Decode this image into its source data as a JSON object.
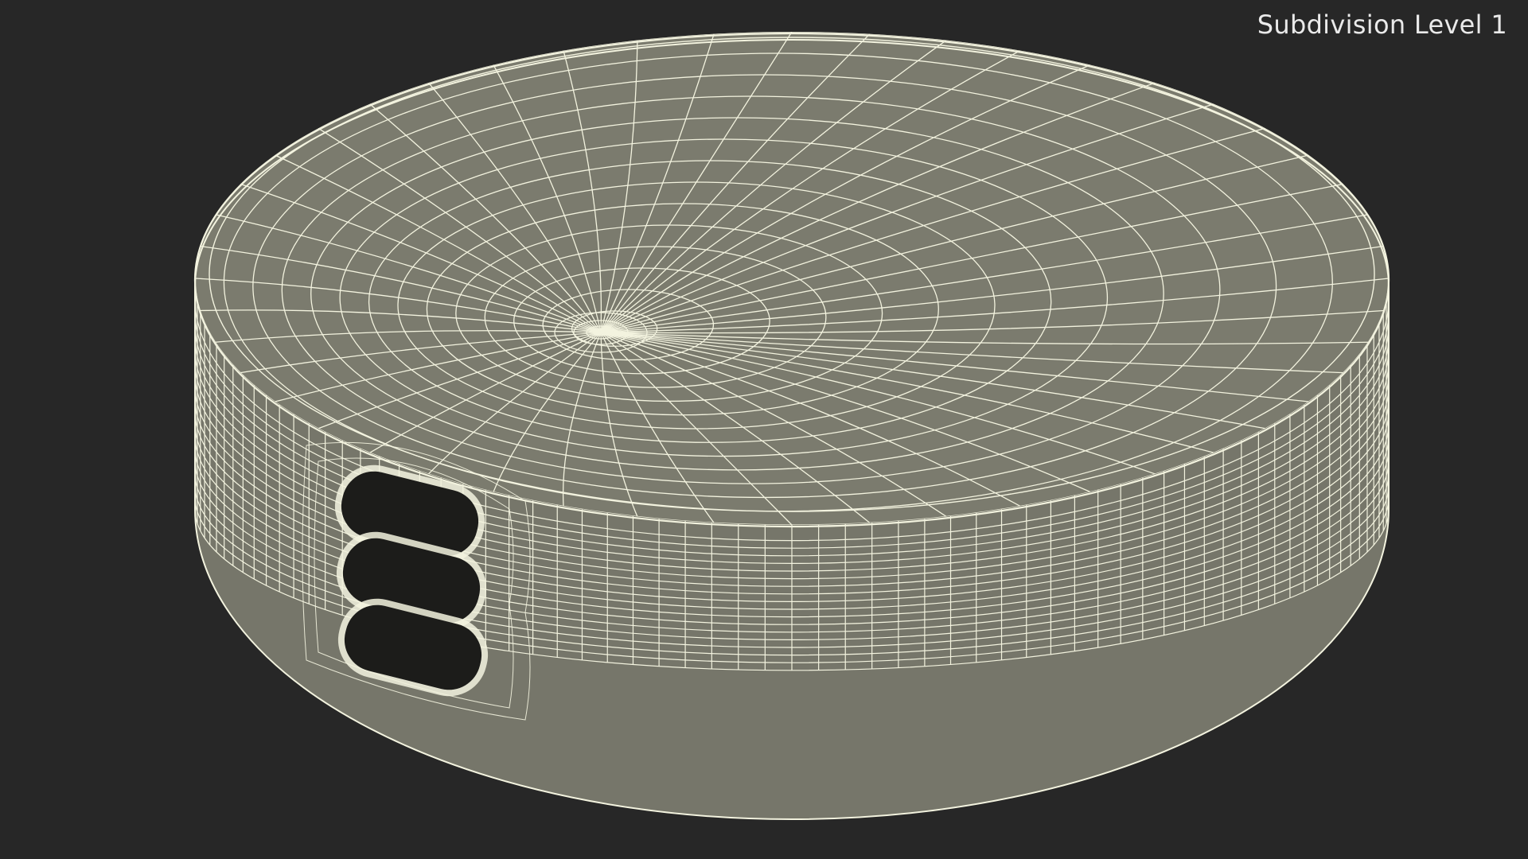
{
  "overlay": {
    "label": "Subdivision Level 1"
  },
  "render": {
    "background_color": "#272727",
    "surface_color": "#7b7b6e",
    "wire_color": "#f3f3df",
    "slot_color": "#1c1c1a",
    "object": "cylindrical puck with three horizontal slots, wireframe subdivision mesh"
  }
}
